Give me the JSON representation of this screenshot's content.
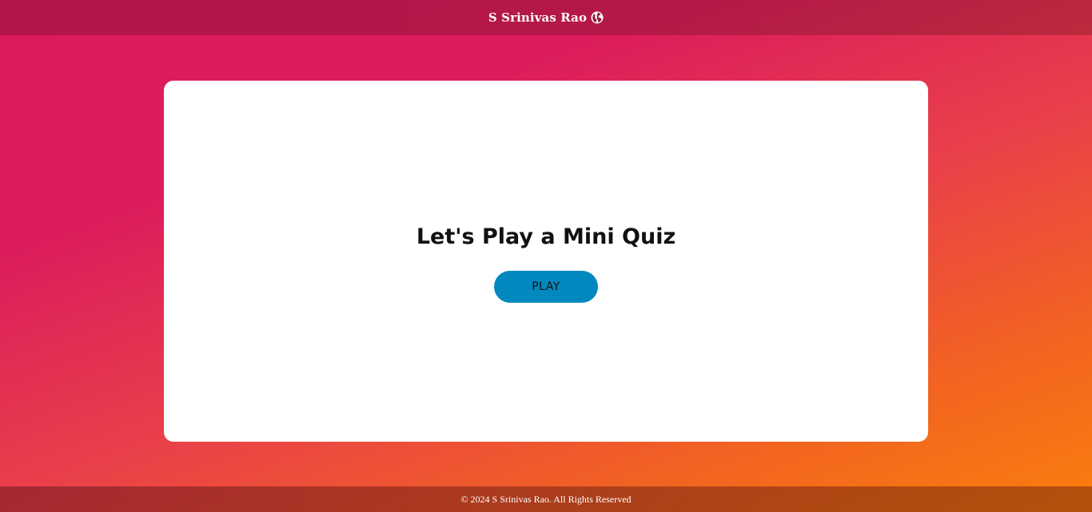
{
  "header": {
    "brand_name": "S Srinivas Rao",
    "brand_icon": "globe-icon"
  },
  "main": {
    "title": "Let's Play a Mini Quiz",
    "play_label": "PLAY"
  },
  "footer": {
    "copyright": "© 2024 S Srinivas Rao. All Rights Reserved"
  },
  "colors": {
    "gradient_start": "#db1b5e",
    "gradient_end": "#fb7e0d",
    "button": "#0088bf",
    "card": "#ffffff"
  }
}
